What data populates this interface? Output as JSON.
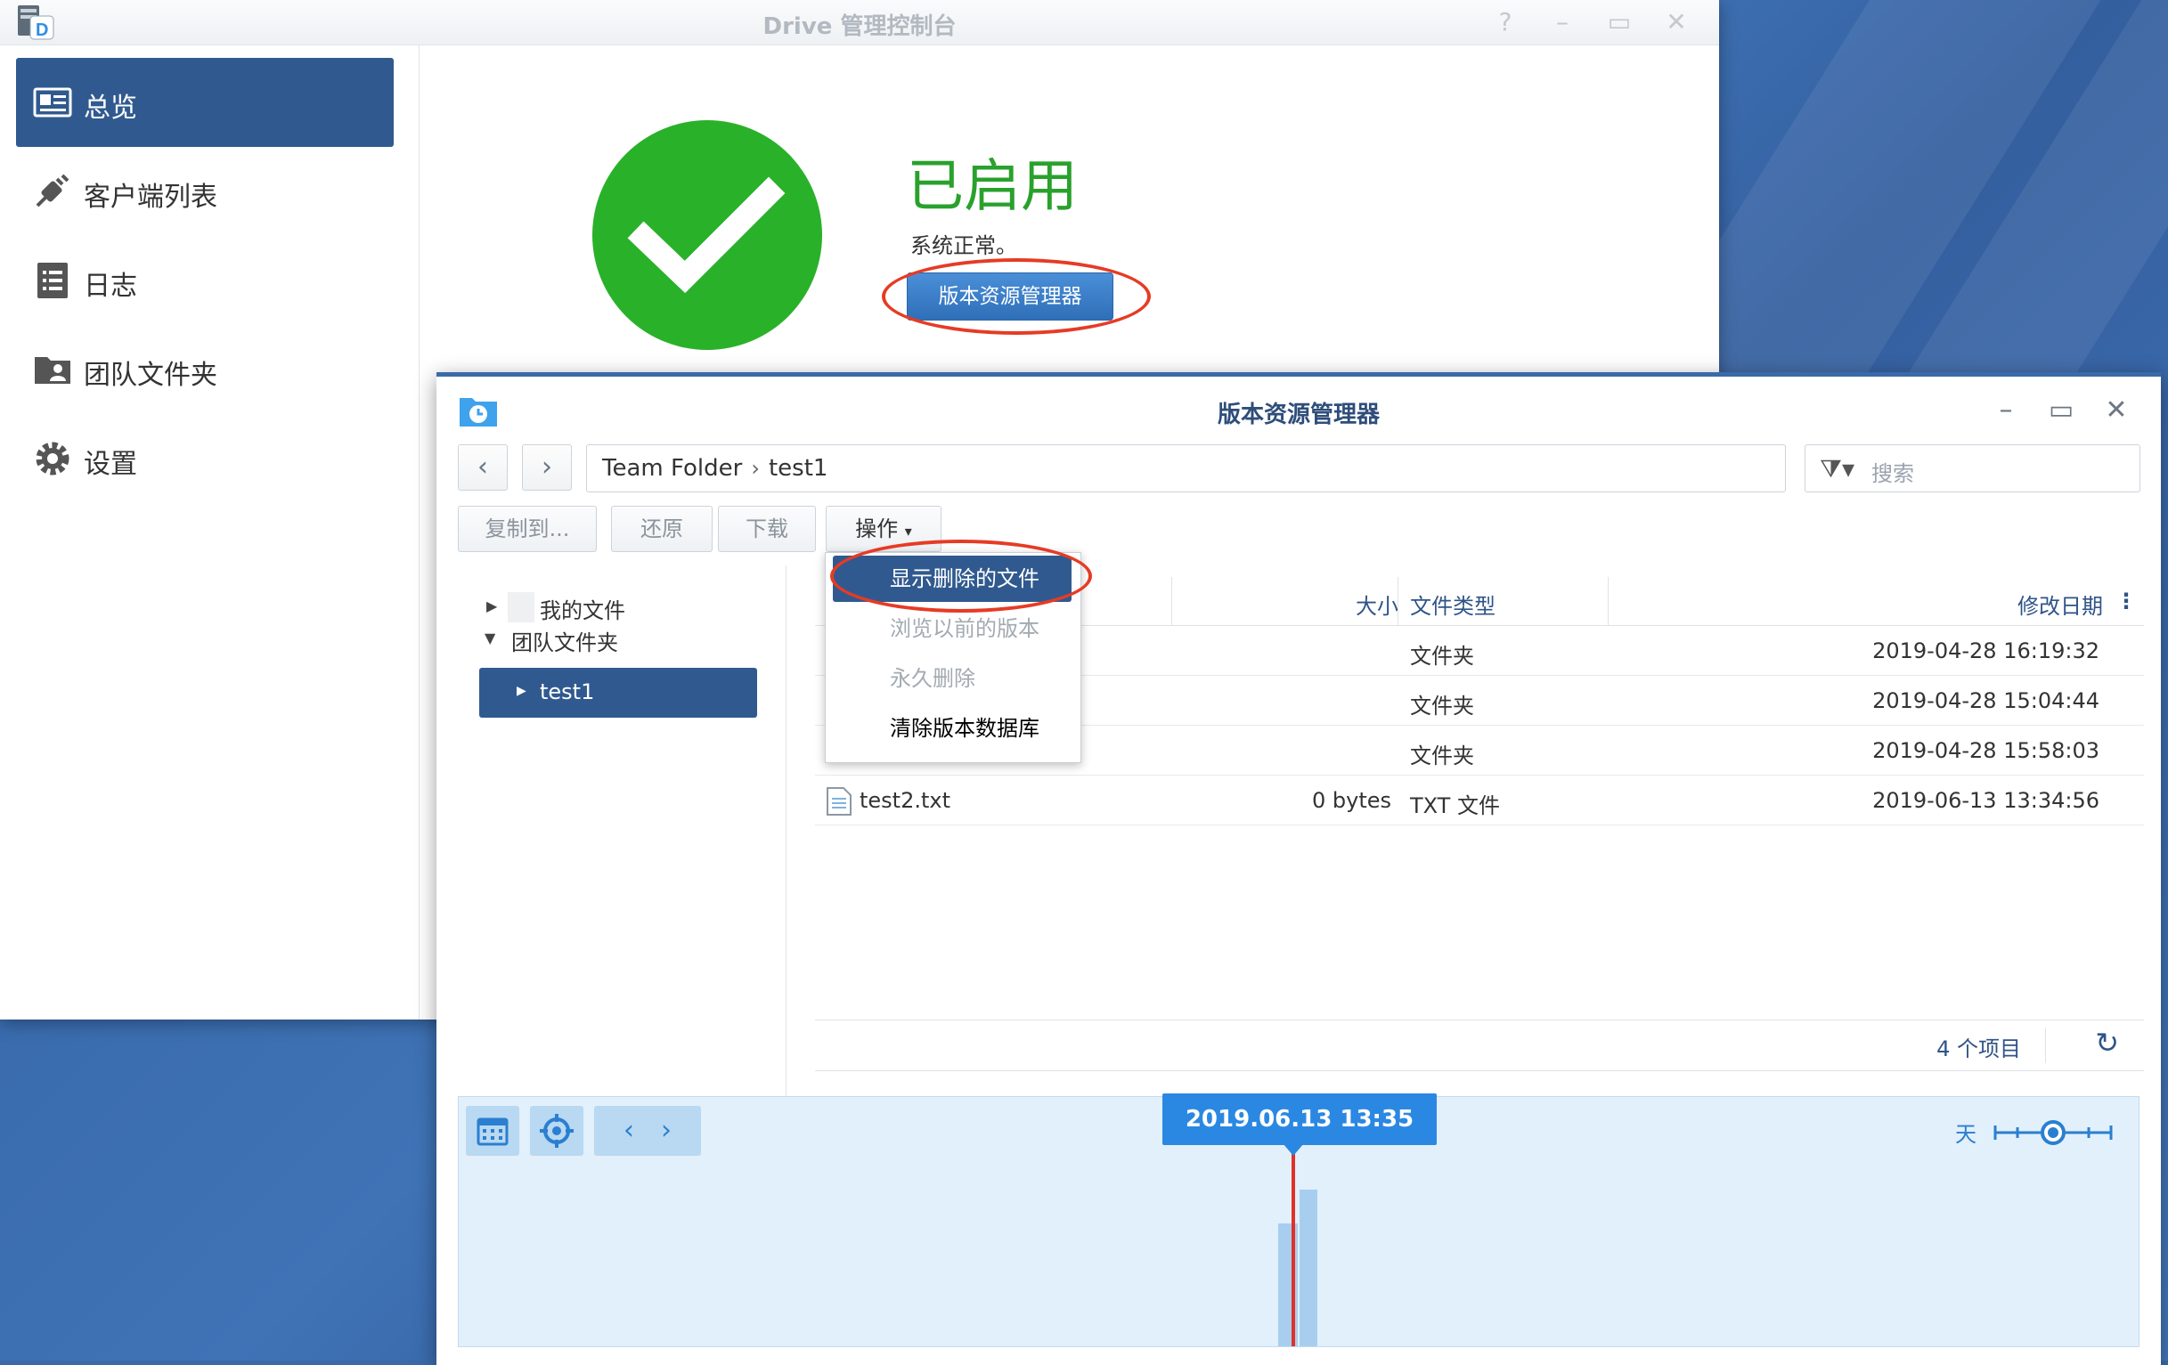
{
  "main_window": {
    "title": "Drive 管理控制台",
    "sidebar": [
      {
        "label": "总览",
        "icon": "overview-card-icon",
        "active": true
      },
      {
        "label": "客户端列表",
        "icon": "plug-icon",
        "active": false
      },
      {
        "label": "日志",
        "icon": "log-list-icon",
        "active": false
      },
      {
        "label": "团队文件夹",
        "icon": "team-folder-icon",
        "active": false
      },
      {
        "label": "设置",
        "icon": "gear-icon",
        "active": false
      }
    ],
    "status": {
      "title": "已启用",
      "description": "系统正常。",
      "button_label": "版本资源管理器",
      "color": "#29b12a"
    }
  },
  "version_explorer": {
    "title": "版本资源管理器",
    "path": [
      "Team Folder",
      "test1"
    ],
    "search_placeholder": "搜索",
    "toolbar": {
      "copy_to": "复制到...",
      "restore": "还原",
      "download": "下载",
      "actions": "操作"
    },
    "actions_menu": [
      {
        "label": "显示删除的文件",
        "state": "highlighted"
      },
      {
        "label": "浏览以前的版本",
        "state": "disabled"
      },
      {
        "label": "永久删除",
        "state": "disabled"
      },
      {
        "label": "清除版本数据库",
        "state": "enabled"
      }
    ],
    "tree": [
      {
        "label": "我的文件",
        "expanded": false
      },
      {
        "label": "团队文件夹",
        "expanded": true
      },
      {
        "label": "test1",
        "selected": true
      }
    ],
    "columns": {
      "size": "大小",
      "type": "文件类型",
      "modified": "修改日期"
    },
    "rows": [
      {
        "name": "",
        "size": "",
        "type": "文件夹",
        "modified": "2019-04-28 16:19:32"
      },
      {
        "name": "",
        "size": "",
        "type": "文件夹",
        "modified": "2019-04-28 15:04:44"
      },
      {
        "name": "",
        "size": "",
        "type": "文件夹",
        "modified": "2019-04-28 15:58:03"
      },
      {
        "name": "test2.txt",
        "size": "0 bytes",
        "type": "TXT 文件",
        "modified": "2019-06-13 13:34:56"
      }
    ],
    "item_count": "4 个项目",
    "timeline": {
      "current_date": "2019.06.13 13:35",
      "zoom_unit": "天",
      "accent_color": "#2b88e2",
      "marker_color": "#e0312a"
    }
  }
}
